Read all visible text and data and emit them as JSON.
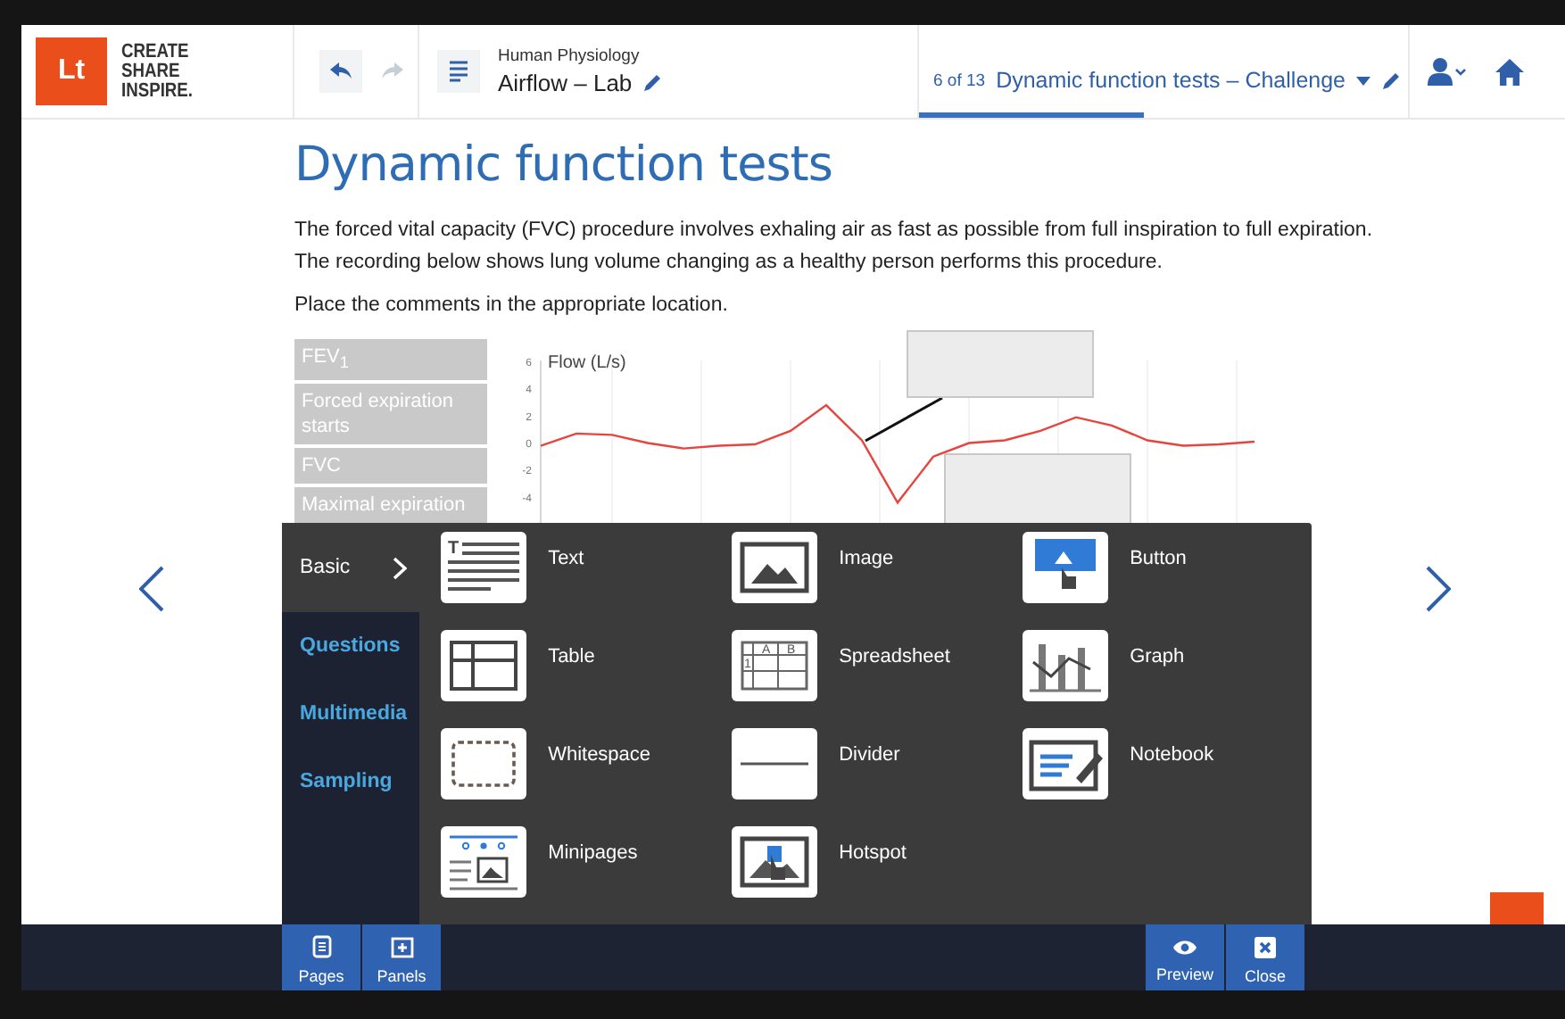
{
  "header": {
    "logo": {
      "mark": "Lt",
      "tagline": [
        "CREATE",
        "SHARE",
        "INSPIRE."
      ]
    },
    "course": "Human Physiology",
    "lesson": "Airflow – Lab",
    "page_tab": {
      "counter": "6 of 13",
      "title": "Dynamic function tests – Challenge",
      "level": 0.46
    }
  },
  "content": {
    "title": "Dynamic function tests",
    "paragraphs": [
      "The forced vital capacity (FVC) procedure involves exhaling air as fast as possible from full inspiration to full expiration.\nThe recording below shows lung volume changing as a healthy person performs this procedure.",
      "Place the comments in the appropriate location."
    ],
    "comment_labels": [
      "FEV$_{1}$",
      "Forced expiration starts",
      "FVC",
      "Maximal expiration"
    ],
    "chart": {
      "chart_data": {
        "type": "line",
        "ylabel": "Flow  (L/s)",
        "yticks": [
          6,
          4,
          2,
          0,
          -2,
          -4
        ],
        "ylim": [
          -6,
          6
        ],
        "grid": true,
        "series": [
          {
            "color": "#e8433c",
            "values": [
              -0.3,
              0.6,
              0.5,
              -0.1,
              -0.5,
              -0.3,
              -0.2,
              0.8,
              2.7,
              0.1,
              -4.5,
              -1.1,
              -0.1,
              0.1,
              0.8,
              1.8,
              1.2,
              0.1,
              -0.3,
              -0.2,
              0
            ]
          }
        ]
      }
    }
  },
  "insert_panel": {
    "categories": [
      {
        "label": "Basic",
        "selected": true
      },
      {
        "label": "Questions",
        "selected": false
      },
      {
        "label": "Multimedia",
        "selected": false
      },
      {
        "label": "Sampling",
        "selected": false
      }
    ],
    "items": [
      {
        "label": "Text",
        "kind": "text",
        "icon_text": [
          "T"
        ]
      },
      {
        "label": "Image",
        "kind": "image"
      },
      {
        "label": "Button",
        "kind": "button"
      },
      {
        "label": "Table",
        "kind": "table"
      },
      {
        "label": "Spreadsheet",
        "kind": "spreadsheet",
        "icon_text": [
          "A",
          "B",
          "1"
        ]
      },
      {
        "label": "Graph",
        "kind": "graph"
      },
      {
        "label": "Whitespace",
        "kind": "whitespace"
      },
      {
        "label": "Divider",
        "kind": "divider"
      },
      {
        "label": "Notebook",
        "kind": "notebook"
      },
      {
        "label": "Minipages",
        "kind": "minipages"
      },
      {
        "label": "Hotspot",
        "kind": "hotspot"
      }
    ]
  },
  "bottom_bar": {
    "left_buttons": [
      {
        "label": "Pages",
        "kind": "pages"
      },
      {
        "label": "Panels",
        "kind": "panels"
      }
    ],
    "right_buttons": [
      {
        "label": "Preview",
        "kind": "preview"
      },
      {
        "label": "Close",
        "kind": "close"
      }
    ]
  }
}
